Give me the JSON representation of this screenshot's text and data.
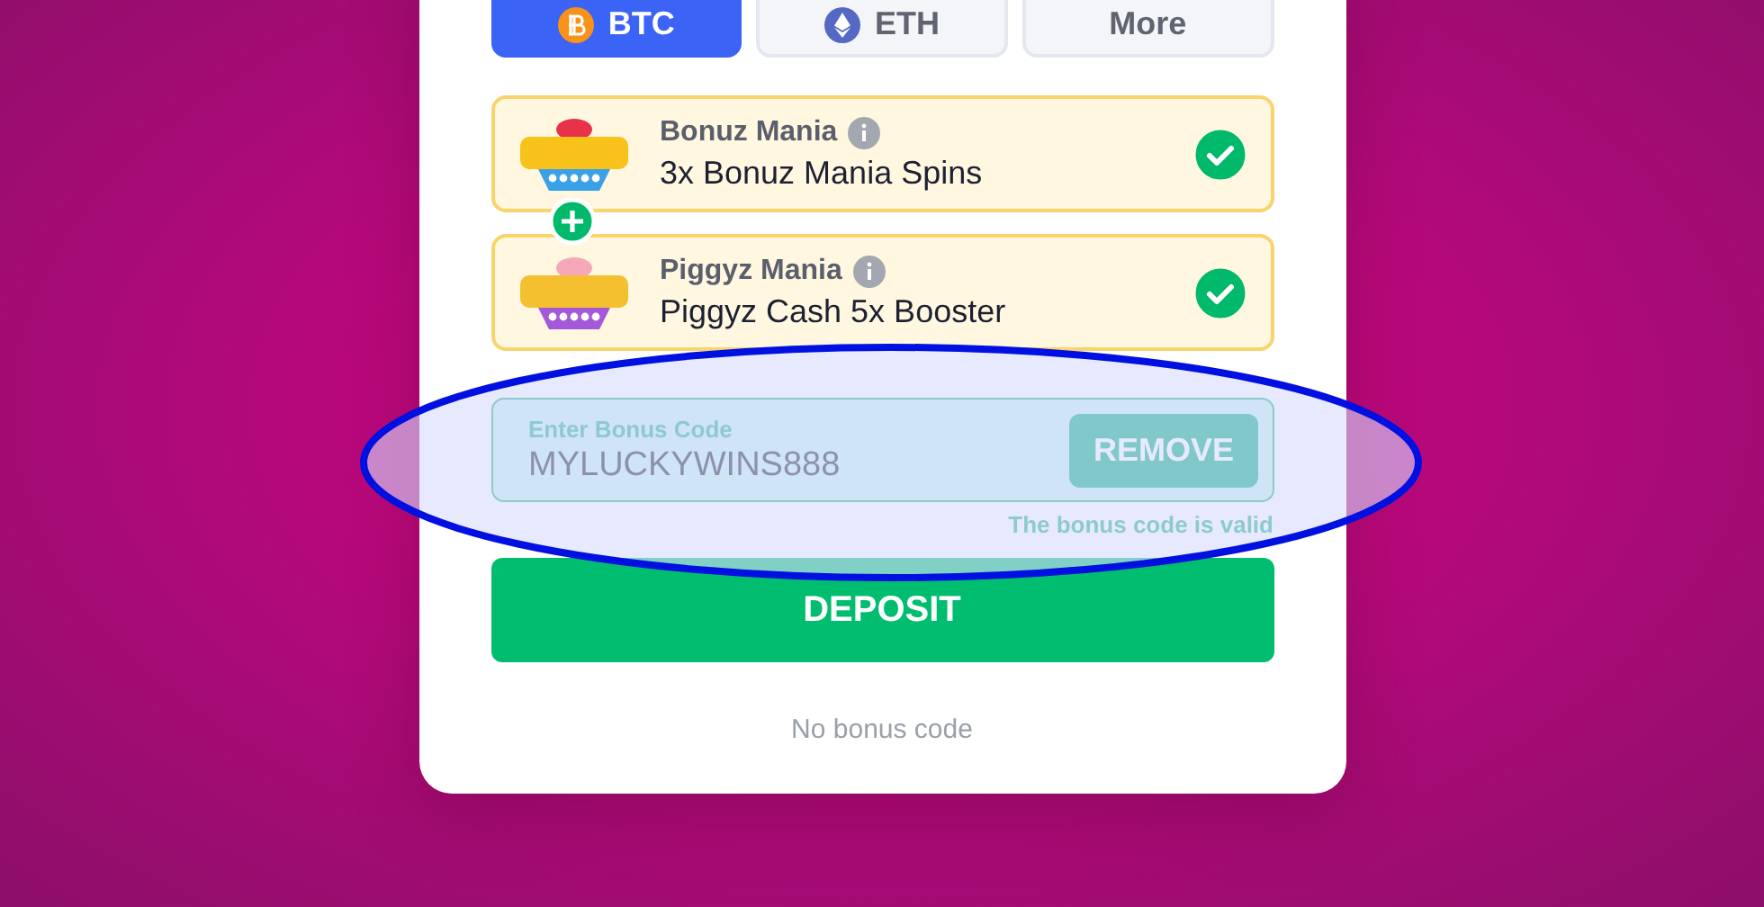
{
  "currency_tabs": [
    {
      "label": "BTC",
      "kind": "btc",
      "selected": true
    },
    {
      "label": "ETH",
      "kind": "eth",
      "selected": false
    },
    {
      "label": "More",
      "kind": "none",
      "selected": false
    }
  ],
  "bonuses": [
    {
      "title": "Bonuz Mania",
      "description": "3x Bonuz Mania Spins",
      "kind": "bonuz",
      "checked": true
    },
    {
      "title": "Piggyz Mania",
      "description": "Piggyz Cash 5x Booster",
      "kind": "piggyz",
      "checked": true
    }
  ],
  "bonus_code": {
    "label": "Enter Bonus Code",
    "value": "MYLUCKYWINS888",
    "button": "REMOVE",
    "message": "The bonus code is valid",
    "valid": true
  },
  "deposit_button": "DEPOSIT",
  "no_bonus_link": "No bonus code",
  "highlight": {
    "shown": true
  }
}
